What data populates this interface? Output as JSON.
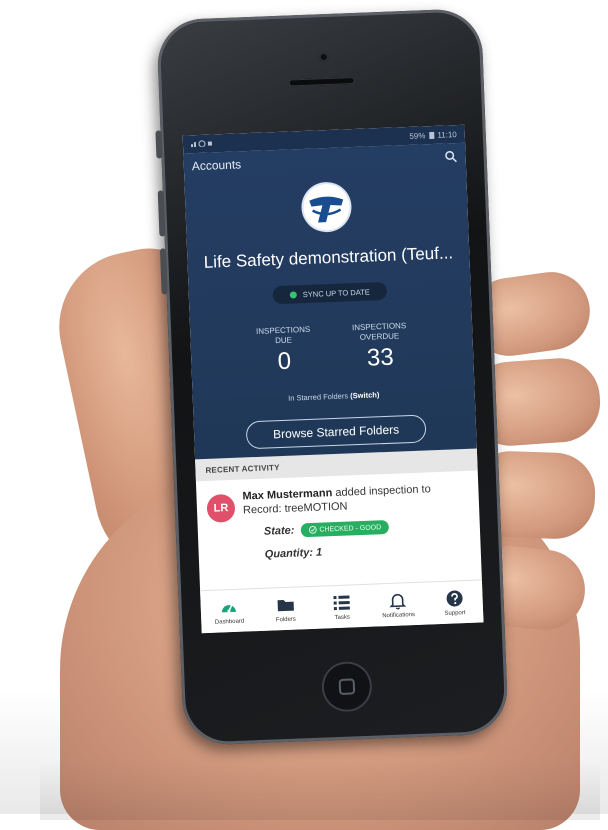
{
  "status_bar": {
    "left_icons": [
      "signal-icon",
      "wifi-icon"
    ],
    "battery": "59%",
    "time": "11:10"
  },
  "header": {
    "accounts_link": "Accounts",
    "search_icon": "search-icon"
  },
  "hero": {
    "title": "Life Safety demonstration (Teuf...",
    "sync_status": "SYNC UP TO DATE",
    "stats": [
      {
        "label_line1": "INSPECTIONS",
        "label_line2": "DUE",
        "value": "0"
      },
      {
        "label_line1": "INSPECTIONS",
        "label_line2": "OVERDUE",
        "value": "33"
      }
    ],
    "starred_prefix": "In Starred Folders ",
    "starred_switch": "(Switch)",
    "browse_button": "Browse Starred Folders"
  },
  "recent_activity": {
    "header": "RECENT ACTIVITY",
    "item": {
      "avatar_initials": "LR",
      "user": "Max Mustermann",
      "action": " added inspection to Record: treeMOTION",
      "state_label": "State:",
      "state_value": "CHECKED - GOOD",
      "quantity": "Quantity: 1"
    }
  },
  "tabbar": {
    "tabs": [
      {
        "label": "Dashboard",
        "icon": "dashboard-icon"
      },
      {
        "label": "Folders",
        "icon": "folder-icon"
      },
      {
        "label": "Tasks",
        "icon": "list-icon"
      },
      {
        "label": "Notifications",
        "icon": "bell-icon"
      },
      {
        "label": "Support",
        "icon": "help-icon"
      }
    ]
  },
  "colors": {
    "hero_bg": "#243d63",
    "accent_green": "#27ae60",
    "avatar_red": "#e0506a",
    "tab_active": "#1aa37a"
  }
}
